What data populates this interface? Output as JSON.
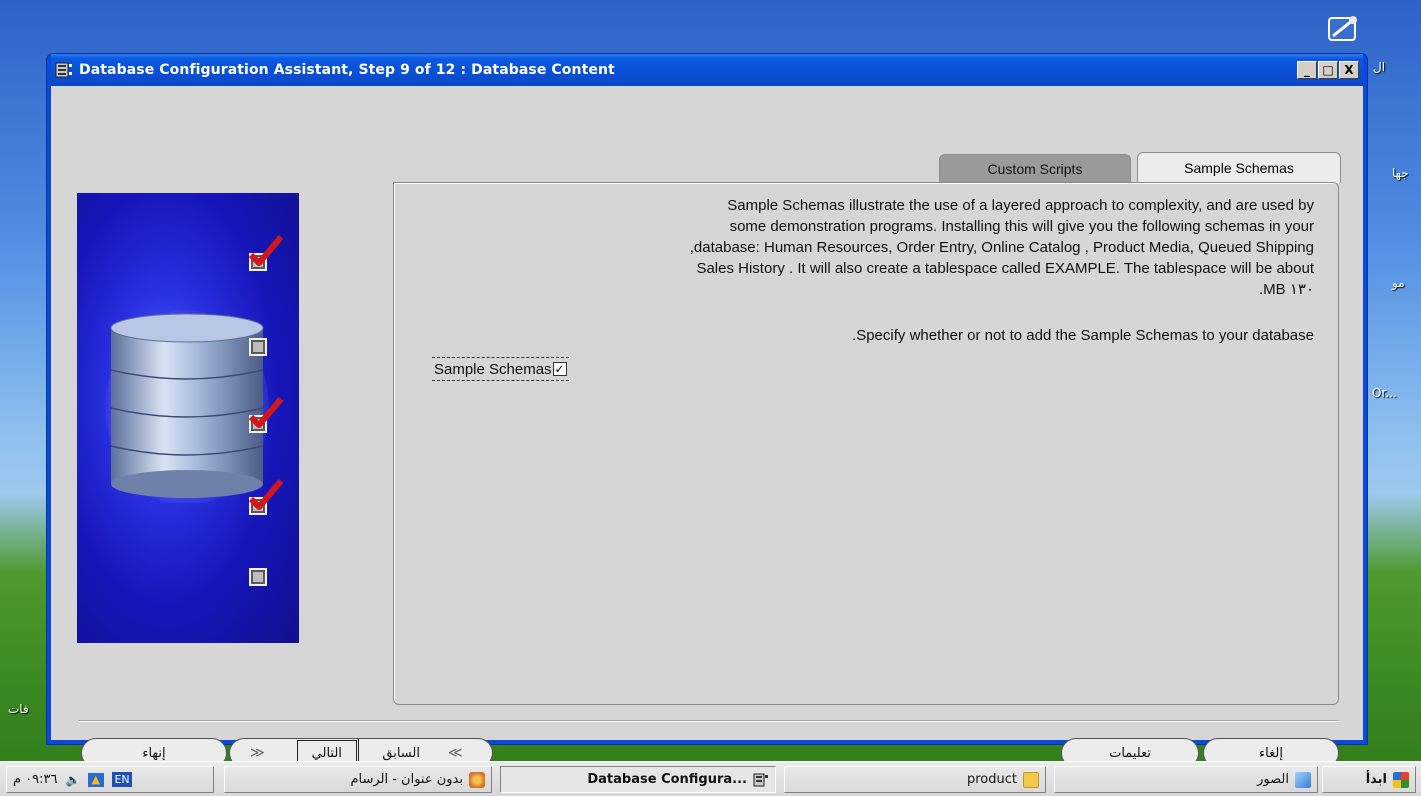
{
  "desktop": {
    "labels": [
      "ال",
      "جها",
      "مو",
      "Or...",
      "فات"
    ]
  },
  "window": {
    "title": "Database Configuration Assistant, Step 9 of 12 : Database Content",
    "controls": {
      "minimize": "_",
      "maximize": "□",
      "close": "X"
    }
  },
  "tabs": [
    {
      "label": "Custom Scripts",
      "selected": false
    },
    {
      "label": "Sample Schemas",
      "selected": true
    }
  ],
  "content": {
    "description_lines": [
      "Sample Schemas illustrate the use of a layered approach to complexity, and are used by",
      "some demonstration programs. Installing this will give you the following schemas in your",
      ",database: Human Resources, Order Entry, Online Catalog , Product Media, Queued Shipping",
      "Sales History . It will also create a tablespace called EXAMPLE. The tablespace will be about",
      ".MB ١٣٠"
    ],
    "specify": ".Specify whether or not to add the Sample Schemas to your database",
    "checkbox": {
      "label": "Sample Schemas",
      "checked": true,
      "mark": "✓"
    }
  },
  "steps": [
    {
      "checked": true
    },
    {
      "checked": false
    },
    {
      "checked": true
    },
    {
      "checked": true
    },
    {
      "checked": false
    }
  ],
  "buttons": {
    "finish": "إنهاء",
    "next": "التالي",
    "next_arrow": "≫",
    "back": "السابق",
    "back_arrow": "≪",
    "help": "تعليمات",
    "cancel": "إلغاء"
  },
  "taskbar": {
    "start": "ابدأ",
    "items": [
      {
        "label": "الصور",
        "active": false
      },
      {
        "label": "product",
        "active": false
      },
      {
        "label": "Database Configura...",
        "active": true
      },
      {
        "label": "بدون عنوان - الرسام",
        "active": false
      }
    ],
    "lang": "EN",
    "clock": "٠٩:٣٦ م"
  },
  "colors": {
    "title_blue": "#0a4fd4",
    "panel_bg": "#d6d6d6",
    "check_red": "#d2171c"
  }
}
